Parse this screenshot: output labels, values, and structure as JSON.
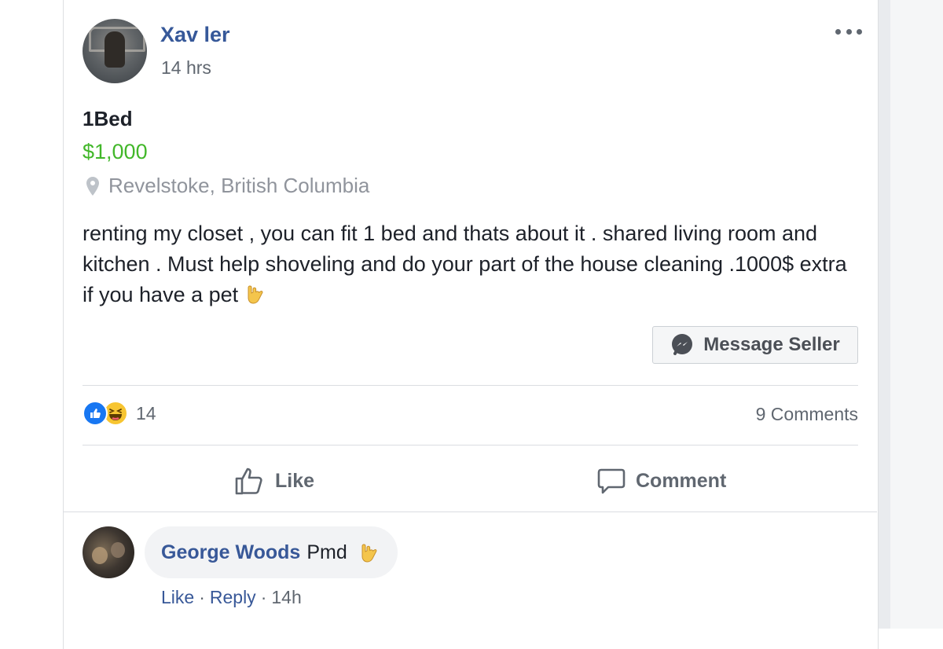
{
  "post": {
    "author": "Xav ler",
    "time": "14 hrs",
    "listing": {
      "title": "1Bed",
      "price": "$1,000",
      "location": "Revelstoke, British Columbia"
    },
    "body_text": "renting my closet , you can fit 1 bed and thats about it . shared living room and kitchen . Must help shoveling and do your part of the house cleaning .1000$ extra if you have a pet",
    "body_emoji": "call-me-hand",
    "message_button": "Message Seller",
    "reactions": {
      "types": [
        "like",
        "haha"
      ],
      "count": "14"
    },
    "comments_count": "9 Comments",
    "actions": {
      "like": "Like",
      "comment": "Comment"
    }
  },
  "comment": {
    "author": "George Woods",
    "text": "Pmd",
    "emoji": "call-me-hand",
    "actions": {
      "like": "Like",
      "reply": "Reply",
      "time": "14h"
    }
  },
  "colors": {
    "link_blue": "#365899",
    "price_green": "#42b72a",
    "secondary_text": "#606770",
    "like_blue": "#1877f2",
    "haha_yellow": "#f7c531"
  }
}
